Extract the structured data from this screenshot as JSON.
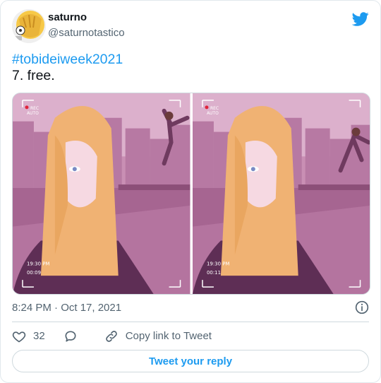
{
  "author": {
    "name": "saturno",
    "handle": "@saturnotastico"
  },
  "tweet": {
    "hashtag": "#tobideiweek2021",
    "text": "7. free."
  },
  "media": {
    "left": {
      "rec": "REC",
      "auto": "AUTO",
      "time": "19:30 PM",
      "counter": "00:09"
    },
    "right": {
      "rec": "REC",
      "auto": "AUTO",
      "time": "19:30 PM",
      "counter": "00:11"
    }
  },
  "meta": {
    "timestamp": "8:24 PM · Oct 17, 2021"
  },
  "actions": {
    "likes": "32",
    "copy_link": "Copy link to Tweet"
  },
  "reply_button": "Tweet your reply",
  "colors": {
    "twitter_blue": "#1d9bf0",
    "muted_text": "#536471",
    "border": "#cfd9de"
  }
}
